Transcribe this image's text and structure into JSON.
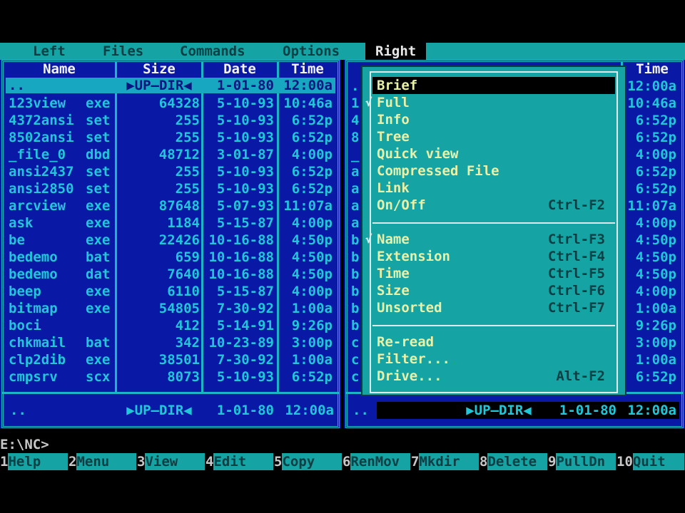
{
  "menu": {
    "left": "Left",
    "files": "Files",
    "commands": "Commands",
    "options": "Options",
    "right": "Right"
  },
  "left_panel": {
    "headers": {
      "name": "Name",
      "size": "Size",
      "date": "Date",
      "time": "Time"
    },
    "top_row": {
      "name": "..",
      "size": "▶UP—DIR◀",
      "date": "1-01-80",
      "time": "12:00a"
    },
    "files": [
      {
        "name": "123view",
        "ext": "exe",
        "size": "64328",
        "date": "5-10-93",
        "time": "10:46a"
      },
      {
        "name": "4372ansi",
        "ext": "set",
        "size": "255",
        "date": "5-10-93",
        "time": "6:52p"
      },
      {
        "name": "8502ansi",
        "ext": "set",
        "size": "255",
        "date": "5-10-93",
        "time": "6:52p"
      },
      {
        "name": "_file_0",
        "ext": "dbd",
        "size": "48712",
        "date": "3-01-87",
        "time": "4:00p"
      },
      {
        "name": "ansi2437",
        "ext": "set",
        "size": "255",
        "date": "5-10-93",
        "time": "6:52p"
      },
      {
        "name": "ansi2850",
        "ext": "set",
        "size": "255",
        "date": "5-10-93",
        "time": "6:52p"
      },
      {
        "name": "arcview",
        "ext": "exe",
        "size": "87648",
        "date": "5-07-93",
        "time": "11:07a"
      },
      {
        "name": "ask",
        "ext": "exe",
        "size": "1184",
        "date": "5-15-87",
        "time": "4:00p"
      },
      {
        "name": "be",
        "ext": "exe",
        "size": "22426",
        "date": "10-16-88",
        "time": "4:50p"
      },
      {
        "name": "bedemo",
        "ext": "bat",
        "size": "659",
        "date": "10-16-88",
        "time": "4:50p"
      },
      {
        "name": "bedemo",
        "ext": "dat",
        "size": "7640",
        "date": "10-16-88",
        "time": "4:50p"
      },
      {
        "name": "beep",
        "ext": "exe",
        "size": "6110",
        "date": "5-15-87",
        "time": "4:00p"
      },
      {
        "name": "bitmap",
        "ext": "exe",
        "size": "54805",
        "date": "7-30-92",
        "time": "1:00a"
      },
      {
        "name": "boci",
        "ext": "",
        "size": "412",
        "date": "5-14-91",
        "time": "9:26p"
      },
      {
        "name": "chkmail",
        "ext": "bat",
        "size": "342",
        "date": "10-23-89",
        "time": "3:00p"
      },
      {
        "name": "clp2dib",
        "ext": "exe",
        "size": "38501",
        "date": "7-30-92",
        "time": "1:00a"
      },
      {
        "name": "cmpsrv",
        "ext": "scx",
        "size": "8073",
        "date": "5-10-93",
        "time": "6:52p"
      }
    ],
    "status": {
      "name": "..",
      "size": "▶UP—DIR◀",
      "date": "1-01-80",
      "time": "12:00a"
    }
  },
  "right_panel": {
    "headers": {
      "time": "Time"
    },
    "name_initials": [
      "..",
      "1",
      "4",
      "8",
      "_",
      "a",
      "a",
      "a",
      "a",
      "b",
      "b",
      "b",
      "b",
      "b",
      "b",
      "c",
      "c",
      "c"
    ],
    "times": [
      "12:00a",
      "10:46a",
      "6:52p",
      "6:52p",
      "4:00p",
      "6:52p",
      "6:52p",
      "11:07a",
      "4:00p",
      "4:50p",
      "4:50p",
      "4:50p",
      "4:00p",
      "1:00a",
      "9:26p",
      "3:00p",
      "1:00a",
      "6:52p"
    ],
    "status": {
      "name": "..",
      "size": "▶UP—DIR◀",
      "date": "1-01-80",
      "time": "12:00a"
    }
  },
  "dropdown": {
    "group1": [
      {
        "label": "Brief",
        "key": ""
      },
      {
        "label": "Full",
        "key": ""
      },
      {
        "label": "Info",
        "key": ""
      },
      {
        "label": "Tree",
        "key": ""
      },
      {
        "label": "Quick view",
        "key": ""
      },
      {
        "label": "Compressed File",
        "key": ""
      },
      {
        "label": "Link",
        "key": ""
      },
      {
        "label": "On/Off",
        "key": "Ctrl-F2"
      }
    ],
    "group2": [
      {
        "label": "Name",
        "key": "Ctrl-F3"
      },
      {
        "label": "Extension",
        "key": "Ctrl-F4"
      },
      {
        "label": "Time",
        "key": "Ctrl-F5"
      },
      {
        "label": "Size",
        "key": "Ctrl-F6"
      },
      {
        "label": "Unsorted",
        "key": "Ctrl-F7"
      }
    ],
    "group3": [
      {
        "label": "Re-read",
        "key": ""
      },
      {
        "label": "Filter...",
        "key": ""
      },
      {
        "label": "Drive...",
        "key": "Alt-F2"
      }
    ]
  },
  "command_line": "E:\\NC>",
  "fkeys": [
    {
      "num": "1",
      "label": "Help"
    },
    {
      "num": "2",
      "label": "Menu"
    },
    {
      "num": "3",
      "label": "View"
    },
    {
      "num": "4",
      "label": "Edit"
    },
    {
      "num": "5",
      "label": "Copy"
    },
    {
      "num": "6",
      "label": "RenMov"
    },
    {
      "num": "7",
      "label": "Mkdir"
    },
    {
      "num": "8",
      "label": "Delete"
    },
    {
      "num": "9",
      "label": "PullDn"
    },
    {
      "num": "10",
      "label": "Quit"
    }
  ],
  "colors": {
    "panel_bg": "#0a18a6",
    "panel_text": "#20c7d8",
    "menu_bg": "#16a3a4",
    "menu_text": "#0b3f44",
    "dropdown_item": "#e9f0a8",
    "selection_bg": "#000000"
  }
}
